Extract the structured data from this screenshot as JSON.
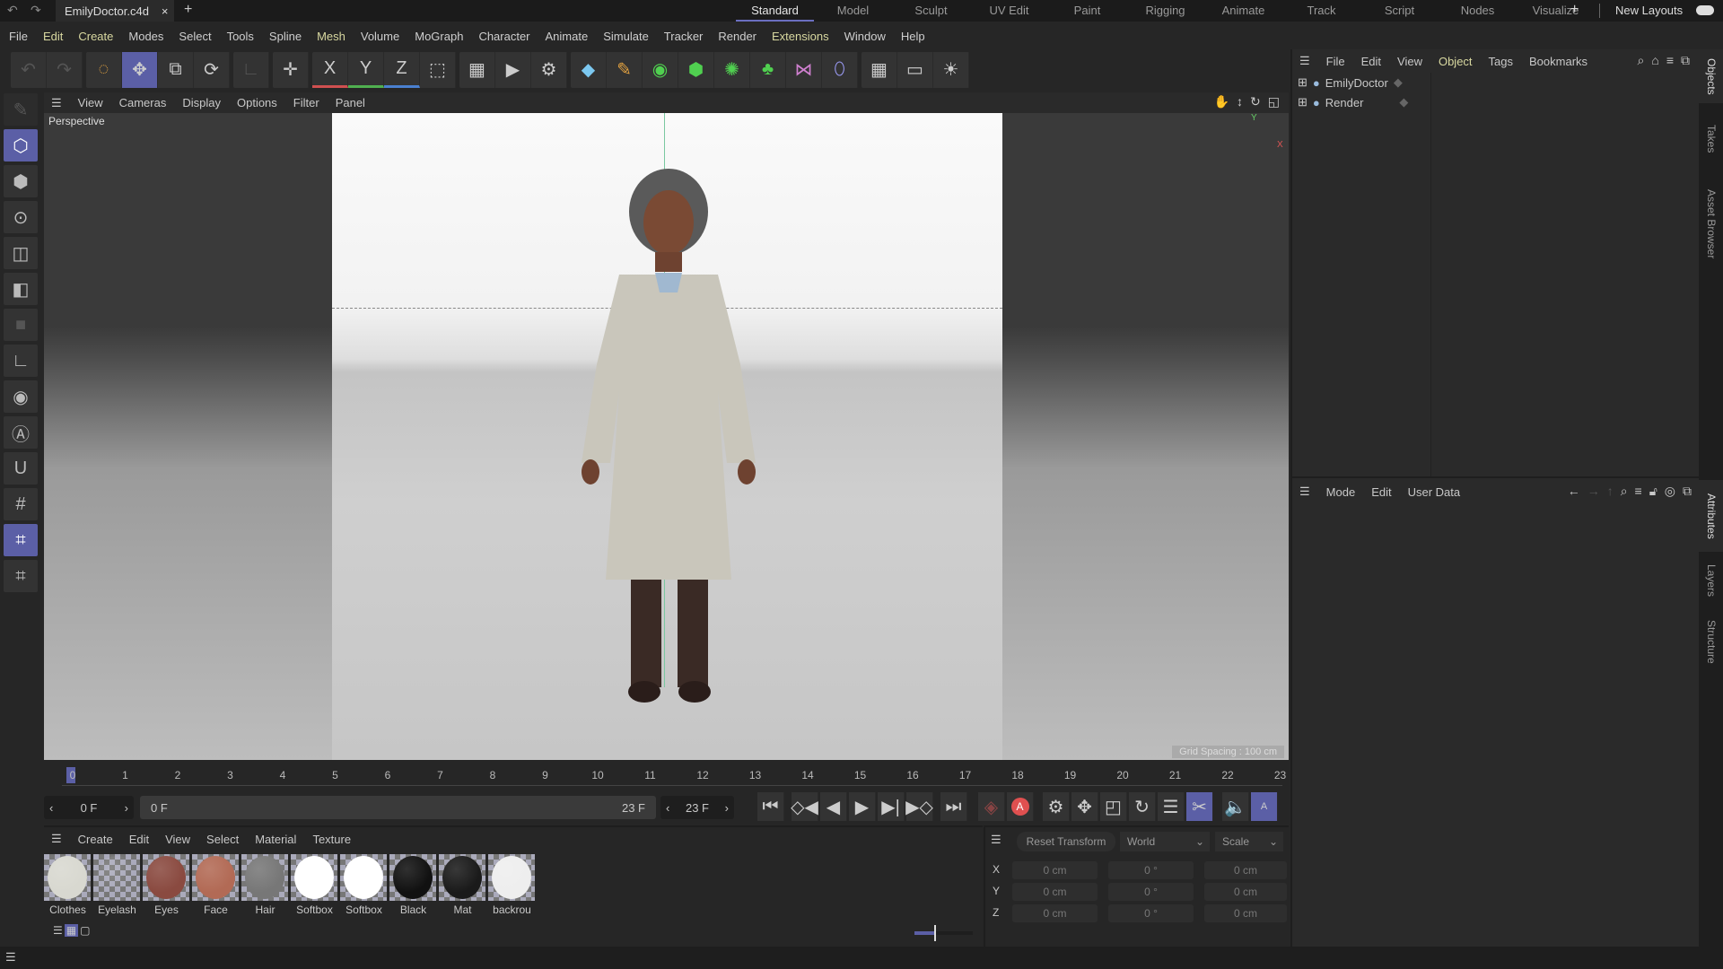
{
  "title_bar": {
    "doc_name": "EmilyDoctor.c4d",
    "close": "×",
    "new_tab": "+",
    "layouts": [
      "Standard",
      "Model",
      "Sculpt",
      "UV Edit",
      "Paint",
      "Rigging",
      "Animate",
      "Track",
      "Script",
      "Nodes",
      "Visualize"
    ],
    "active_layout": "Standard",
    "add_layout": "+",
    "new_layouts": "New Layouts"
  },
  "menu": [
    "File",
    "Edit",
    "Create",
    "Modes",
    "Select",
    "Tools",
    "Spline",
    "Mesh",
    "Volume",
    "MoGraph",
    "Character",
    "Animate",
    "Simulate",
    "Tracker",
    "Render",
    "Extensions",
    "Window",
    "Help"
  ],
  "toolbar_axes": [
    "X",
    "Y",
    "Z"
  ],
  "viewport": {
    "menu": [
      "View",
      "Cameras",
      "Display",
      "Options",
      "Filter",
      "Panel"
    ],
    "camera": "Perspective",
    "grid_spacing": "Grid Spacing : 100 cm",
    "axis_x": "X",
    "axis_y": "Y"
  },
  "objects_panel": {
    "menu": [
      "File",
      "Edit",
      "View",
      "Object",
      "Tags",
      "Bookmarks"
    ],
    "items": [
      "EmilyDoctor",
      "Render"
    ]
  },
  "attributes_panel": {
    "menu": [
      "Mode",
      "Edit",
      "User Data"
    ]
  },
  "side_tabs": [
    "Objects",
    "Takes",
    "Asset Browser",
    "Attributes",
    "Layers",
    "Structure"
  ],
  "timeline": {
    "frames": [
      "0",
      "1",
      "2",
      "3",
      "4",
      "5",
      "6",
      "7",
      "8",
      "9",
      "10",
      "11",
      "12",
      "13",
      "14",
      "15",
      "16",
      "17",
      "18",
      "19",
      "20",
      "21",
      "22",
      "23"
    ],
    "current_frame": "0 F",
    "range_start": "0 F",
    "range_end": "23 F",
    "end_frame": "23 F",
    "autokey": "A",
    "timeline_mode": "A"
  },
  "material_manager": {
    "menu": [
      "Create",
      "Edit",
      "View",
      "Select",
      "Material",
      "Texture"
    ],
    "materials": [
      {
        "name": "Clothes",
        "color": "#d8d8d0"
      },
      {
        "name": "Eyelash",
        "color": "transparent"
      },
      {
        "name": "Eyes",
        "color": "#8a4a40"
      },
      {
        "name": "Face",
        "color": "#b26a55"
      },
      {
        "name": "Hair",
        "color": "#777"
      },
      {
        "name": "Softbox",
        "color": "#ffffff"
      },
      {
        "name": "Softbox",
        "color": "#ffffff"
      },
      {
        "name": "Black",
        "color": "#111"
      },
      {
        "name": "Mat",
        "color": "#1a1a1a"
      },
      {
        "name": "backrou",
        "color": "#eeeeee"
      }
    ]
  },
  "coordinates": {
    "reset": "Reset Transform",
    "space": "World",
    "mode": "Scale",
    "rows": [
      {
        "axis": "X",
        "pos": "0 cm",
        "rot": "0 °",
        "scale": "0 cm"
      },
      {
        "axis": "Y",
        "pos": "0 cm",
        "rot": "0 °",
        "scale": "0 cm"
      },
      {
        "axis": "Z",
        "pos": "0 cm",
        "rot": "0 °",
        "scale": "0 cm"
      }
    ]
  },
  "colors": {
    "accent": "#5b5fa6",
    "record": "#e05050"
  }
}
